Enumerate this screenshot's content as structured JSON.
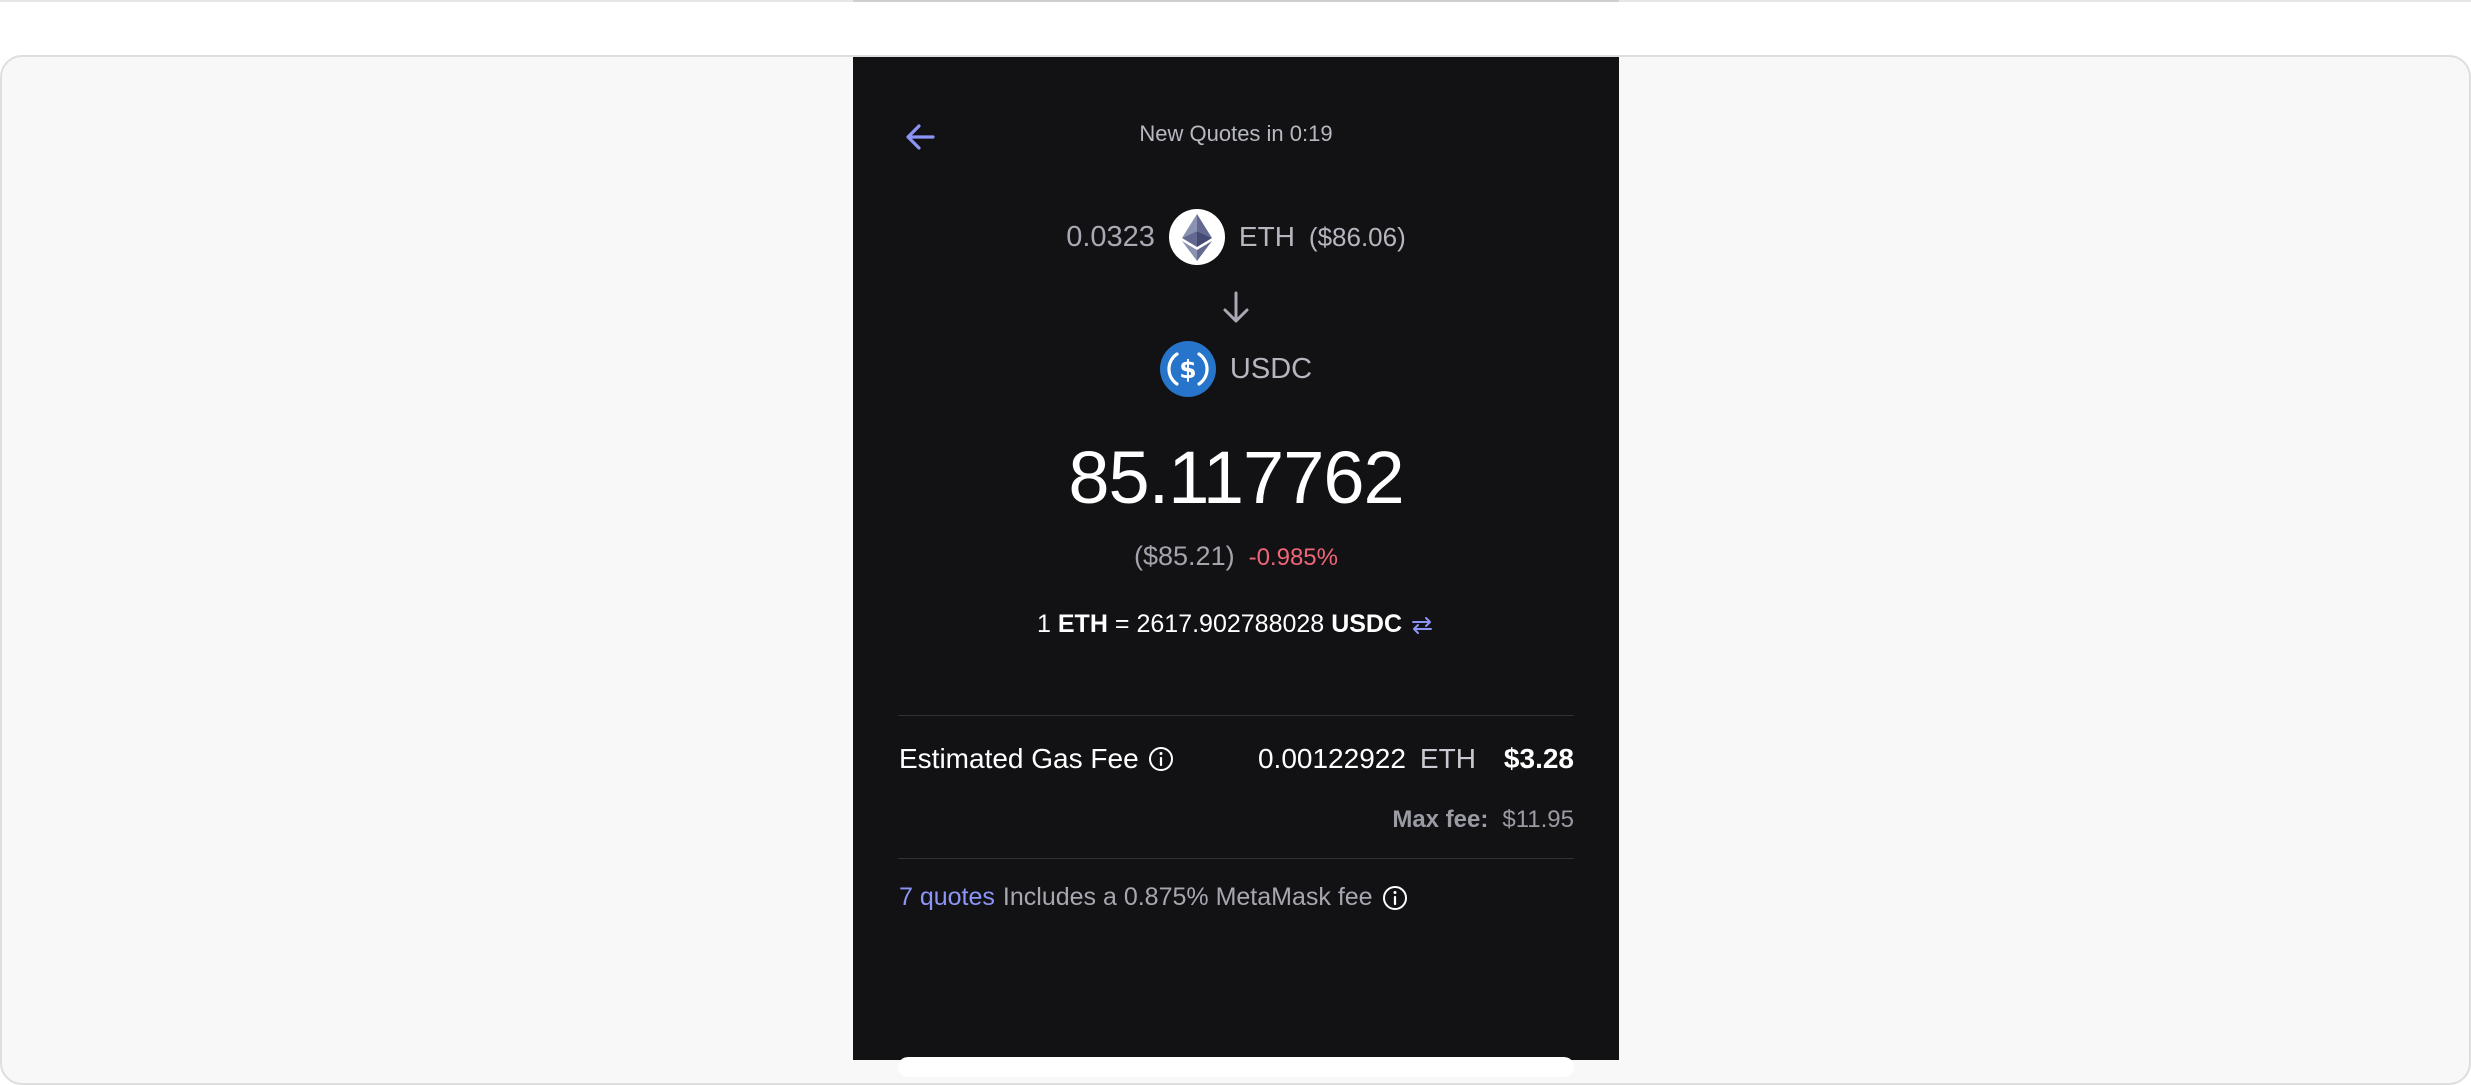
{
  "header": {
    "back_icon": "arrow-left-icon",
    "timer_text": "New Quotes in 0:19"
  },
  "from": {
    "amount": "0.0323",
    "token_icon": "eth-logo-icon",
    "symbol": "ETH",
    "fiat": "($86.06)"
  },
  "direction_icon": "arrow-down-icon",
  "to": {
    "token_icon": "usdc-logo-icon",
    "symbol": "USDC",
    "amount": "85.117762",
    "fiat": "($85.21)",
    "percent_diff": "-0.985%"
  },
  "rate": {
    "prefix": "1",
    "from_symbol": "ETH",
    "equals": "=",
    "value": "2617.902788028",
    "to_symbol": "USDC",
    "swap_icon": "swap-arrows-icon"
  },
  "gas_fee": {
    "label": "Estimated Gas Fee",
    "info_icon": "info-icon",
    "amount": "0.00122922",
    "symbol": "ETH",
    "fiat": "$3.28",
    "max_fee_label": "Max fee:",
    "max_fee_value": "$11.95"
  },
  "quotes": {
    "link_text": "7 quotes",
    "fee_text": "Includes a 0.875% MetaMask fee",
    "info_icon": "info-icon"
  },
  "colors": {
    "background": "#121215",
    "accent": "#8c95f5",
    "negative": "#f06577"
  }
}
